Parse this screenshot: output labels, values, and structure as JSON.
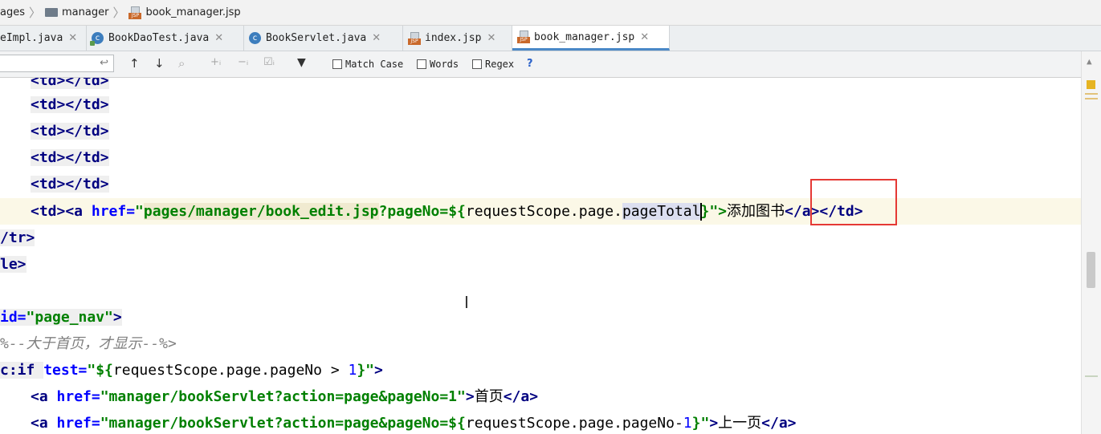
{
  "breadcrumb": {
    "items": [
      "ages",
      "manager",
      "book_manager.jsp"
    ]
  },
  "tabs": [
    {
      "label": "eImpl.java",
      "icon": "none",
      "active": false
    },
    {
      "label": "BookDaoTest.java",
      "icon": "java-class-icon",
      "active": false
    },
    {
      "label": "BookServlet.java",
      "icon": "java-class-icon",
      "active": false
    },
    {
      "label": "index.jsp",
      "icon": "jsp-file-icon",
      "active": false
    },
    {
      "label": "book_manager.jsp",
      "icon": "jsp-file-icon",
      "active": true
    }
  ],
  "find_bar": {
    "search_value": "",
    "options": [
      "Match Case",
      "Words",
      "Regex"
    ],
    "help": "?"
  },
  "code_lines": {
    "l0": [
      "<td></td>"
    ],
    "l1": [
      "<td></td>"
    ],
    "l2": [
      "<td></td>"
    ],
    "l3": [
      "<td></td>"
    ],
    "l4": [
      "<td></td>"
    ],
    "l5": [
      "<td><a ",
      "href=",
      "\"",
      "pages/manager/book_edit.jsp",
      "?pageNo=${",
      "requestScope.page.",
      "pageTotal",
      "}",
      "\">",
      "添加图书",
      "</a></td>"
    ],
    "l6": [
      "/tr>"
    ],
    "l7": [
      "le>"
    ],
    "l8": [
      "id=",
      "\"page_nav\"",
      ">"
    ],
    "l9": [
      "%--大于首页，才显示--%>"
    ],
    "l10": [
      "c:if ",
      "test=",
      "\"${",
      "requestScope.page.pageNo > ",
      "1",
      "}\"",
      ">"
    ],
    "l11": [
      "<a ",
      "href=",
      "\"manager/bookServlet?action=page&pageNo=1\"",
      ">",
      "首页",
      "</a>"
    ],
    "l12": [
      "<a ",
      "href=",
      "\"manager/bookServlet?action=page&pageNo=${",
      "requestScope.page.pageNo-",
      "1",
      "}\"",
      ">",
      "上一页",
      "</a>"
    ]
  }
}
